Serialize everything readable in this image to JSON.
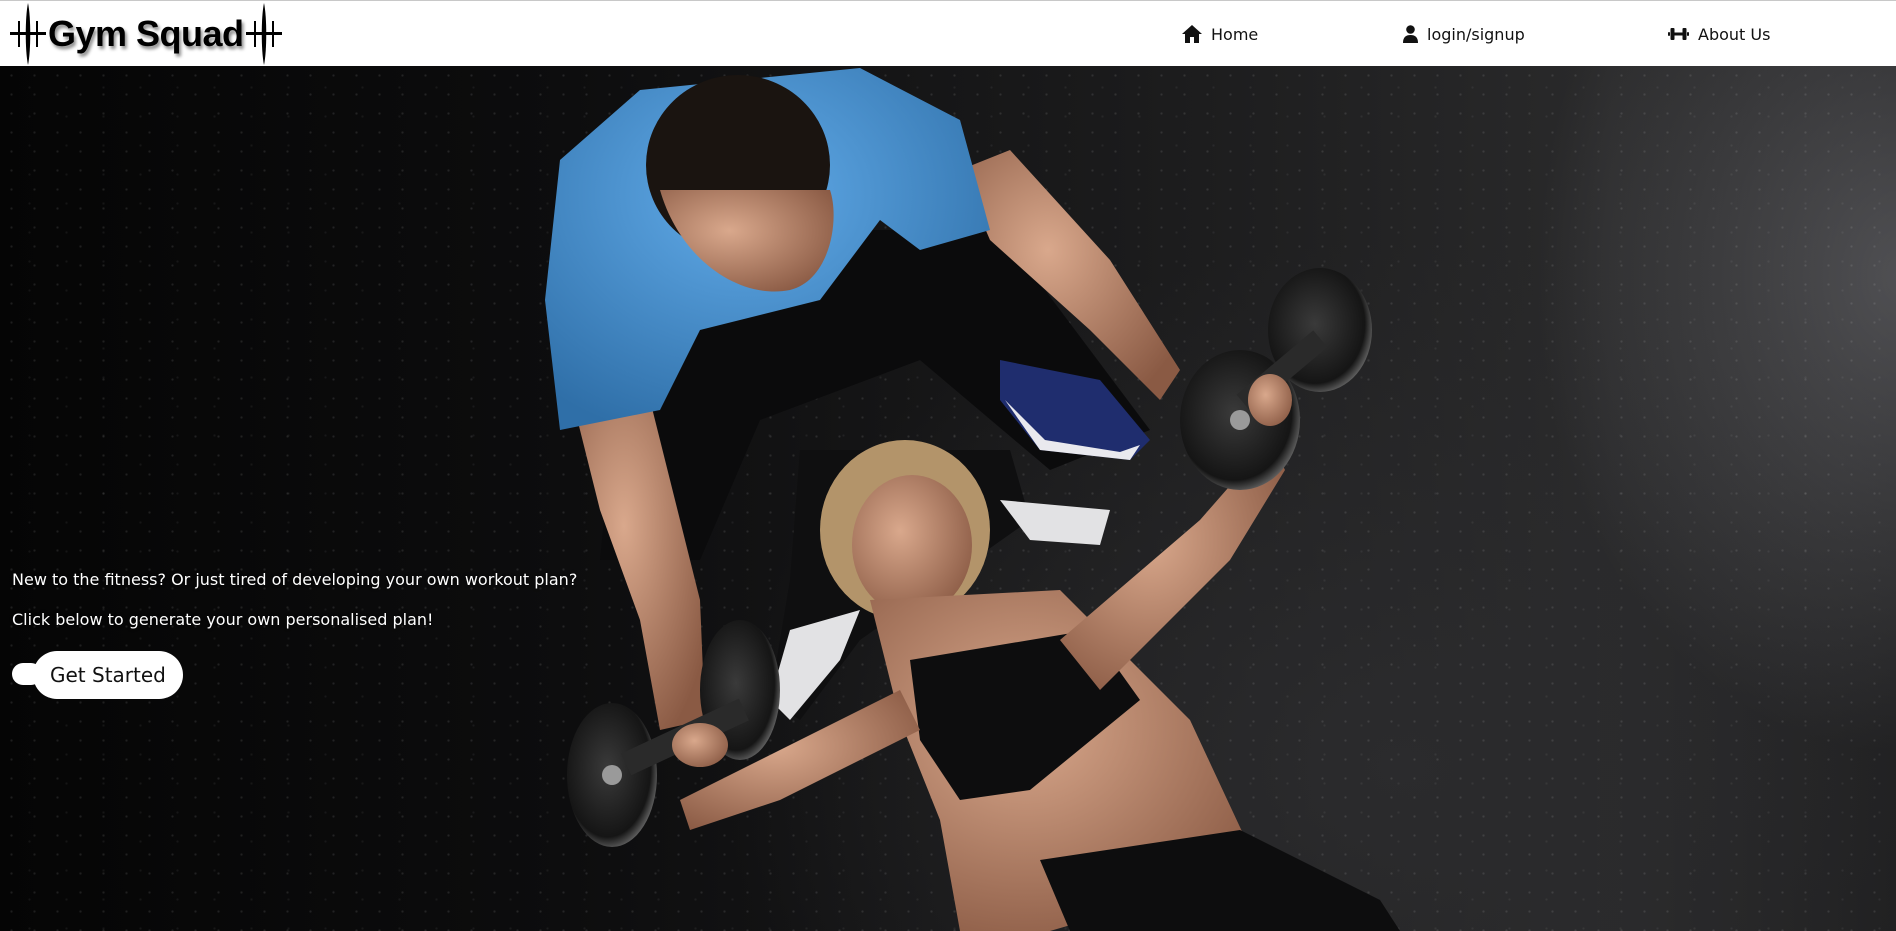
{
  "brand": {
    "name": "Gym Squad",
    "logo_icon": "barbell-mark-icon"
  },
  "nav": {
    "items": [
      {
        "label": "Home",
        "icon": "home-icon"
      },
      {
        "label": "login/signup",
        "icon": "user-icon"
      },
      {
        "label": "About Us",
        "icon": "dumbbell-icon"
      }
    ]
  },
  "hero": {
    "line1": "New to the fitness? Or just tired of developing your own workout plan?",
    "line2": "Click below to generate your own personalised plan!",
    "cta_label": "Get Started",
    "image": "trainer-spotting-woman-bench-press-photo"
  },
  "colors": {
    "header_bg": "#ffffff",
    "hero_bg": "#0d0d0e",
    "shirt_blue": "#4a98d8",
    "text_light": "#ffffff"
  }
}
